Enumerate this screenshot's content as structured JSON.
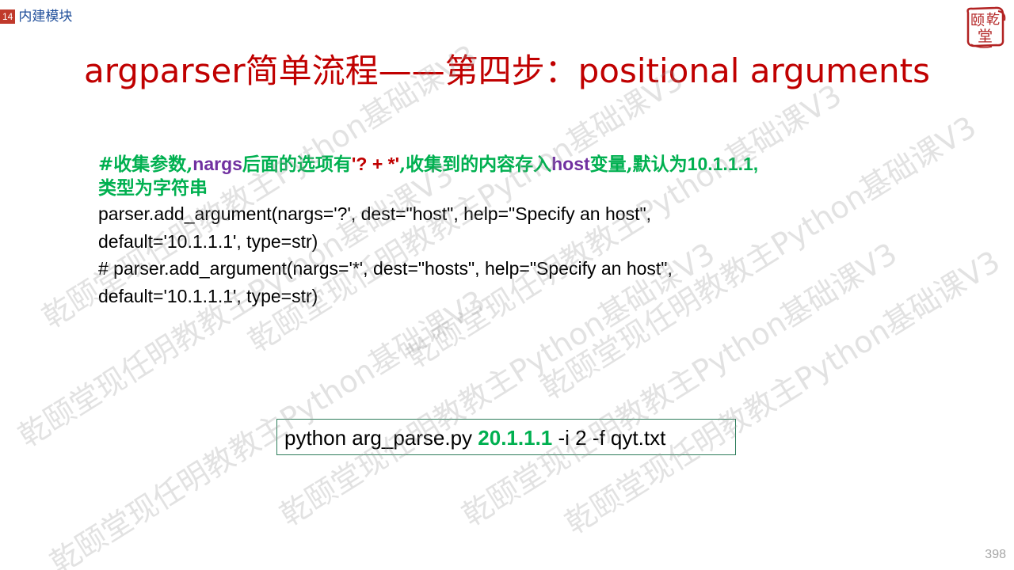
{
  "header": {
    "slide_number": "14",
    "section_title": "内建模块"
  },
  "title": "argparser简单流程——第四步：positional arguments",
  "comment": {
    "part1": "#收集参数,",
    "nargs": "nargs",
    "part2": "后面的选项有",
    "options": "'? + *'",
    "part3": ",收集到的内容存入",
    "host": "host",
    "part4": "变量,默认为",
    "default_ip": "10.1.1.1,",
    "line2": "类型为字符串"
  },
  "code_lines": [
    "parser.add_argument(nargs='?', dest=\"host\", help=\"Specify  an host\",",
    "default='10.1.1.1', type=str)",
    "# parser.add_argument(nargs='*', dest=\"hosts\", help=\"Specify  an host\",",
    "default='10.1.1.1', type=str)"
  ],
  "command": {
    "prefix": "python arg_parse.py ",
    "highlight": "20.1.1.1",
    "suffix": " -i 2 -f qyt.txt"
  },
  "page_number": "398",
  "logo": {
    "chars": [
      "乾",
      "颐",
      "堂"
    ]
  },
  "watermarks": [
    "乾颐堂现任明教教主Python基础课V3"
  ],
  "colors": {
    "title": "#c00000",
    "comment_green": "#00b050",
    "highlight_purple": "#7030a0",
    "header_blue": "#1f4e9a",
    "badge_red": "#c0392b"
  }
}
